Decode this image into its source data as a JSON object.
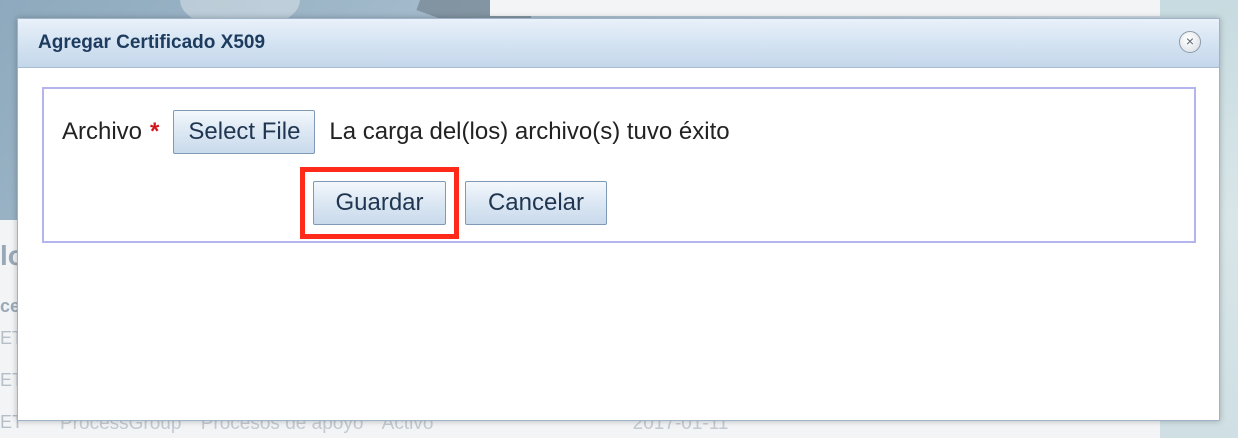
{
  "background": {
    "left_fragments": [
      "lo",
      "ce",
      "ET",
      "ET",
      "ET"
    ],
    "row": {
      "col1": "ProcessGroup",
      "col2": "Procesos de apoyo",
      "col3": "Activo",
      "col4": "2017-01-11"
    }
  },
  "dialog": {
    "title": "Agregar Certificado X509",
    "close_glyph": "×",
    "form": {
      "file_label": "Archivo",
      "required_marker": "*",
      "select_file_label": "Select File",
      "upload_status": "La carga del(los) archivo(s) tuvo éxito",
      "save_label": "Guardar",
      "cancel_label": "Cancelar"
    }
  },
  "colors": {
    "title_text": "#1d3b5e",
    "highlight_border": "#ff2a1a",
    "required_marker": "#d0161c",
    "panel_border": "#b4b4ee"
  }
}
